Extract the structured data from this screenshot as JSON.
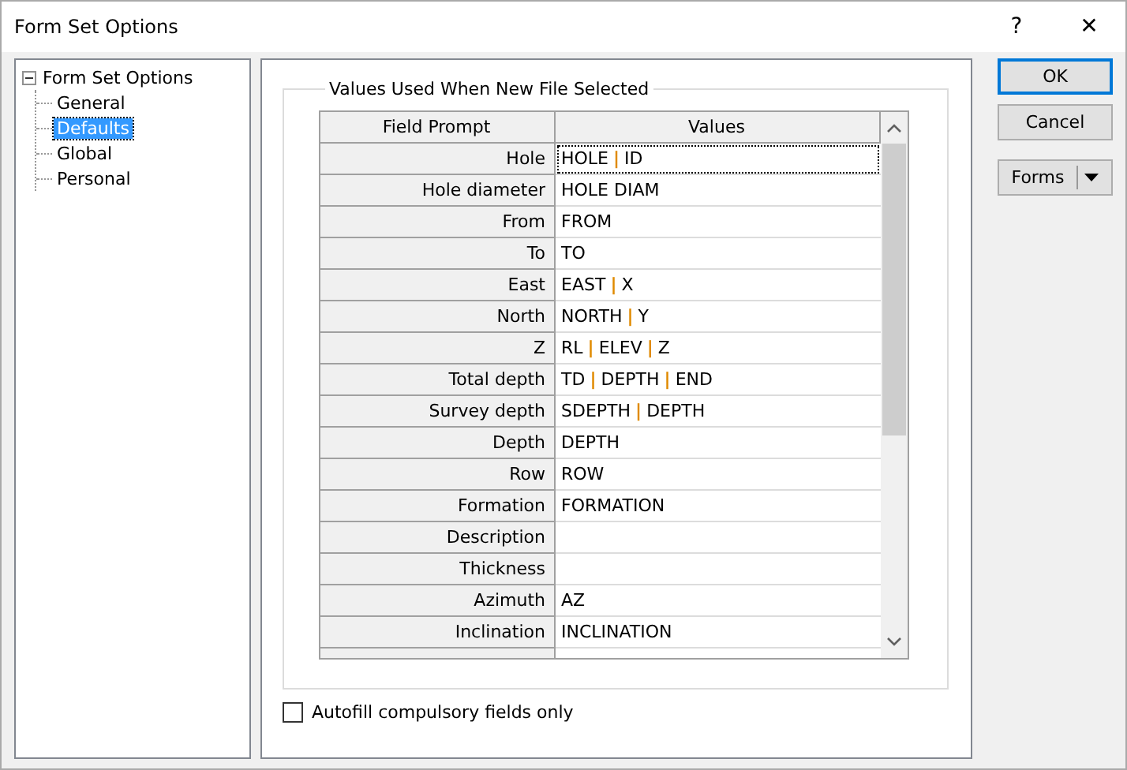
{
  "window": {
    "title": "Form Set Options",
    "help_label": "?",
    "close_label": "✕"
  },
  "tree": {
    "label": "Form Set Options",
    "expanded": true,
    "children": [
      {
        "label": "General",
        "selected": false
      },
      {
        "label": "Defaults",
        "selected": true
      },
      {
        "label": "Global",
        "selected": false
      },
      {
        "label": "Personal",
        "selected": false
      }
    ]
  },
  "group": {
    "title": "Values Used When New File Selected"
  },
  "table": {
    "columns": [
      "Field Prompt",
      "Values"
    ],
    "value_separator": "|",
    "rows": [
      {
        "prompt": "Hole",
        "values": [
          "HOLE",
          "ID"
        ],
        "focused": true
      },
      {
        "prompt": "Hole diameter",
        "values": [
          "HOLE DIAM"
        ],
        "focused": false
      },
      {
        "prompt": "From",
        "values": [
          "FROM"
        ],
        "focused": false
      },
      {
        "prompt": "To",
        "values": [
          "TO"
        ],
        "focused": false
      },
      {
        "prompt": "East",
        "values": [
          "EAST",
          "X"
        ],
        "focused": false
      },
      {
        "prompt": "North",
        "values": [
          "NORTH",
          "Y"
        ],
        "focused": false
      },
      {
        "prompt": "Z",
        "values": [
          "RL",
          "ELEV",
          "Z"
        ],
        "focused": false
      },
      {
        "prompt": "Total depth",
        "values": [
          "TD",
          "DEPTH",
          "END"
        ],
        "focused": false
      },
      {
        "prompt": "Survey depth",
        "values": [
          "SDEPTH",
          "DEPTH"
        ],
        "focused": false
      },
      {
        "prompt": "Depth",
        "values": [
          "DEPTH"
        ],
        "focused": false
      },
      {
        "prompt": "Row",
        "values": [
          "ROW"
        ],
        "focused": false
      },
      {
        "prompt": "Formation",
        "values": [
          "FORMATION"
        ],
        "focused": false
      },
      {
        "prompt": "Description",
        "values": [],
        "focused": false
      },
      {
        "prompt": "Thickness",
        "values": [],
        "focused": false
      },
      {
        "prompt": "Azimuth",
        "values": [
          "AZ"
        ],
        "focused": false
      },
      {
        "prompt": "Inclination",
        "values": [
          "INCLINATION"
        ],
        "focused": false
      }
    ]
  },
  "autofill": {
    "label": "Autofill compulsory fields only",
    "checked": false
  },
  "buttons": [
    {
      "label": "OK",
      "kind": "default"
    },
    {
      "label": "Cancel",
      "kind": "plain"
    },
    {
      "label": "Forms",
      "kind": "split"
    }
  ]
}
